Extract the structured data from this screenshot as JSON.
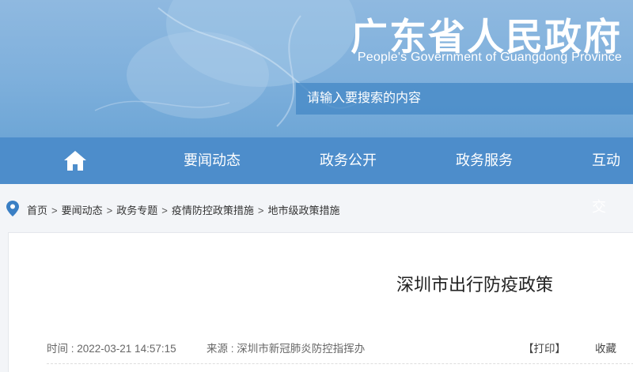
{
  "header": {
    "title": "广东省人民政府",
    "subtitle": "People's Government of Guangdong Province",
    "search_placeholder": "请输入要搜索的内容"
  },
  "nav": {
    "home_icon": "home-icon",
    "items": [
      "要闻动态",
      "政务公开",
      "政务服务",
      "互动交"
    ]
  },
  "breadcrumb": {
    "icon": "location-pin-icon",
    "items": [
      "首页",
      "要闻动态",
      "政务专题",
      "疫情防控政策措施",
      "地市级政策措施"
    ],
    "separator": ">"
  },
  "article": {
    "title": "深圳市出行防疫政策",
    "time": "时间 : 2022-03-21 14:57:15",
    "source": "来源 : 深圳市新冠肺炎防控指挥办",
    "print_label": "【打印】",
    "favorite_label": "收藏"
  },
  "colors": {
    "nav": "#4d8dcb",
    "banner": "#7fb0dc",
    "accent": "#3a7fc4"
  }
}
